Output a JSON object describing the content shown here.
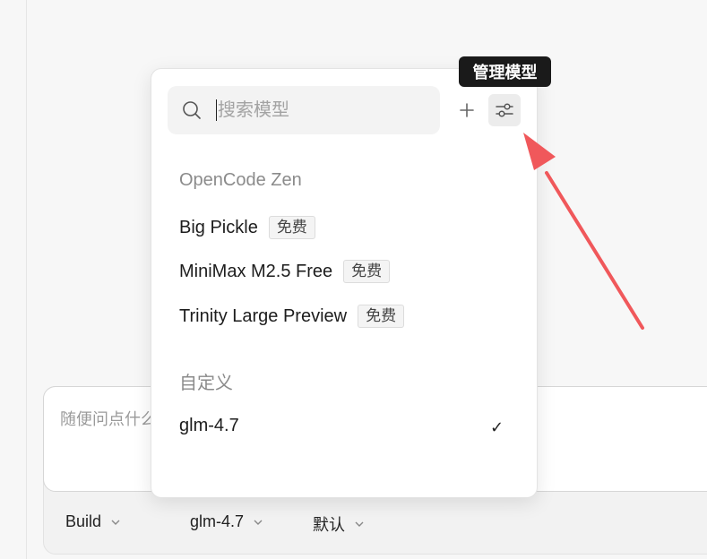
{
  "composer": {
    "placeholder": "随便问点什么..."
  },
  "toolbar": {
    "agent": "Build",
    "model": "glm-4.7",
    "variant": "默认"
  },
  "model_picker": {
    "search_placeholder": "搜索模型",
    "add_label": "+",
    "manage_tooltip": "管理模型",
    "sections": [
      {
        "title": "OpenCode Zen",
        "items": [
          {
            "name": "Big Pickle",
            "badge": "免费"
          },
          {
            "name": "MiniMax M2.5 Free",
            "badge": "免费"
          },
          {
            "name": "Trinity Large Preview",
            "badge": "免费"
          }
        ]
      },
      {
        "title": "自定义",
        "items": [
          {
            "name": "glm-4.7",
            "selected": true,
            "check": "✓"
          }
        ]
      }
    ]
  },
  "annotation": {
    "arrow_color": "#f0585b"
  }
}
